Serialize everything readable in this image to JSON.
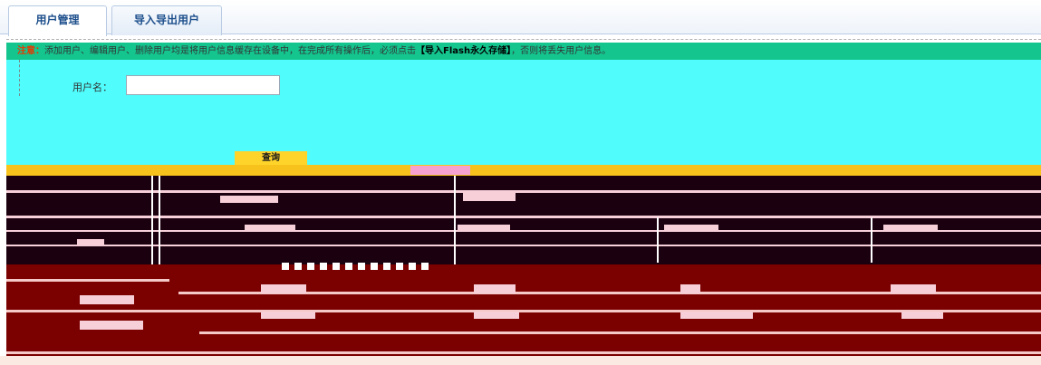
{
  "tabs": [
    {
      "label": "用户管理",
      "active": true
    },
    {
      "label": "导入导出用户",
      "active": false
    }
  ],
  "notice": {
    "lead": "注意：",
    "text": "添加用户、编辑用户、删除用户均是将用户信息缓存在设备中，在完成所有操作后，必须点击",
    "strong": "【导入Flash永久存储】",
    "tail": "，否则将丢失用户信息。"
  },
  "form": {
    "username_label": "用户名：",
    "username_value": "",
    "query_button": "查询"
  },
  "colors": {
    "notice_bg": "#14c58e",
    "form_bg": "#50fcfc",
    "accent_yellow": "#f7c21c",
    "table_dark": "#1b0010",
    "table_maroon": "#7b0000"
  }
}
